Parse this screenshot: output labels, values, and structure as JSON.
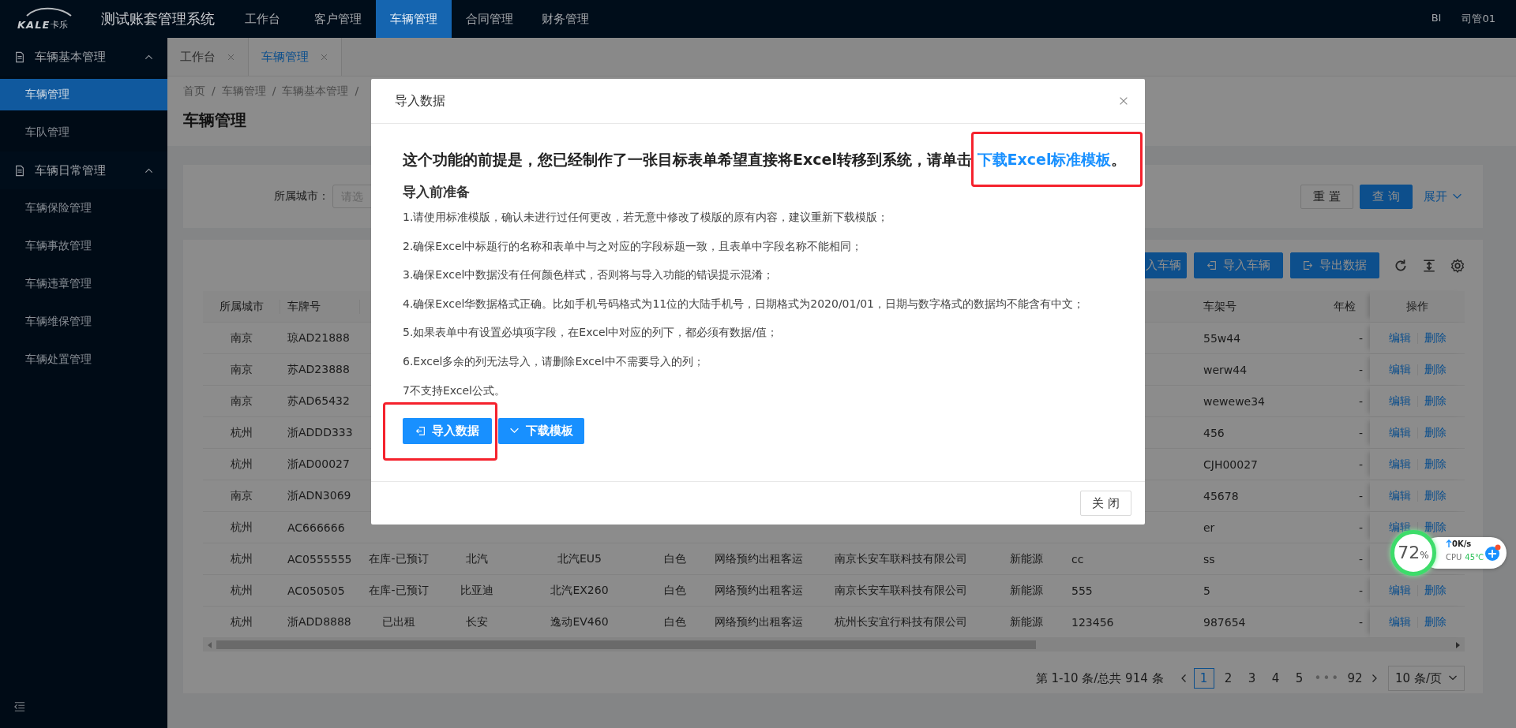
{
  "app": {
    "logo": {
      "mark": "KALE",
      "sub": "卡乐"
    },
    "title": "测试账套管理系统"
  },
  "nav": [
    {
      "label": "工作台",
      "selected": false
    },
    {
      "label": "客户管理",
      "selected": false
    },
    {
      "label": "车辆管理",
      "selected": true
    },
    {
      "label": "合同管理",
      "selected": false
    },
    {
      "label": "财务管理",
      "selected": false
    }
  ],
  "user_menu": [
    "BI",
    "司管01"
  ],
  "sidebar": {
    "groups": [
      {
        "label": "车辆基本管理",
        "expanded": true,
        "items": [
          {
            "label": "车辆管理",
            "selected": true
          },
          {
            "label": "车队管理",
            "selected": false
          }
        ]
      },
      {
        "label": "车辆日常管理",
        "expanded": true,
        "items": [
          {
            "label": "车辆保险管理",
            "selected": false
          },
          {
            "label": "车辆事故管理",
            "selected": false
          },
          {
            "label": "车辆违章管理",
            "selected": false
          },
          {
            "label": "车辆维保管理",
            "selected": false
          },
          {
            "label": "车辆处置管理",
            "selected": false
          }
        ]
      }
    ]
  },
  "tabs": [
    {
      "label": "工作台",
      "selected": false
    },
    {
      "label": "车辆管理",
      "selected": true
    }
  ],
  "breadcrumb": {
    "items": [
      "首页",
      "车辆管理",
      "车辆基本管理"
    ],
    "separator": "/"
  },
  "page_title": "车辆管理",
  "filter": {
    "label": "所属城市：",
    "placeholder": "请选",
    "buttons": [
      {
        "label": "重 置",
        "kind": "default"
      },
      {
        "label": "查 询",
        "kind": "primary"
      }
    ],
    "expand": "展开"
  },
  "toolbar": {
    "buttons": [
      {
        "label": "入车辆",
        "kind": "plain"
      },
      {
        "label": "导入车辆",
        "kind": "import"
      },
      {
        "label": "导出数据",
        "kind": "export"
      }
    ]
  },
  "table": {
    "columns": {
      "city": "所属城市",
      "plate": "车牌号",
      "frame_number": "车架号",
      "inspection": "年检",
      "actions": "操作"
    },
    "rows": [
      {
        "city": "南京",
        "plate": "琼AD21888",
        "frame_number": "55w44",
        "inspection": "-",
        "actions": [
          "编辑",
          "删除"
        ]
      },
      {
        "city": "南京",
        "plate": "苏AD23888",
        "frame_number": "werw44",
        "inspection": "-",
        "actions": [
          "编辑",
          "删除"
        ]
      },
      {
        "city": "南京",
        "plate": "苏AD65432",
        "frame_number": "wewewe34",
        "inspection": "-",
        "actions": [
          "编辑",
          "删除"
        ]
      },
      {
        "city": "杭州",
        "plate": "浙ADDD333",
        "frame_number": "456",
        "inspection": "-",
        "actions": [
          "编辑",
          "删除"
        ]
      },
      {
        "city": "杭州",
        "plate": "浙AD00027",
        "frame_number": "CJH00027",
        "inspection": "-",
        "actions": [
          "编辑",
          "删除"
        ]
      },
      {
        "city": "南京",
        "plate": "浙ADN3069",
        "frame_number": "45678",
        "inspection": "-",
        "actions": [
          "编辑",
          "删除"
        ]
      },
      {
        "city": "杭州",
        "plate": "AC666666",
        "frame_number": "er",
        "inspection": "-",
        "actions": [
          "编辑",
          "删除"
        ]
      },
      {
        "city": "杭州",
        "plate": "AC0555555",
        "column_3": "在库-已预订",
        "column_4": "北汽",
        "column_5": "北汽EU5",
        "column_6": "白色",
        "column_7": "网络预约出租客运",
        "column_8": "南京长安车联科技有限公司",
        "column_9": "新能源",
        "column_10": "cc",
        "frame_number": "ss",
        "inspection": "-"
      },
      {
        "city": "杭州",
        "plate": "AC050505",
        "column_3": "在库-已预订",
        "column_4": "比亚迪",
        "column_5": "北汽EX260",
        "column_6": "白色",
        "column_7": "网络预约出租客运",
        "column_8": "南京长安车联科技有限公司",
        "column_9": "新能源",
        "column_10": "555",
        "frame_number": "5",
        "inspection": "-",
        "actions": [
          "编辑",
          "删除"
        ]
      },
      {
        "city": "杭州",
        "plate": "浙ADD8888",
        "column_3": "已出租",
        "column_4": "长安",
        "column_5": "逸动EV460",
        "column_6": "白色",
        "column_7": "网络预约出租客运",
        "column_8": "杭州长安宜行科技有限公司",
        "column_9": "新能源",
        "column_10": "123456",
        "frame_number": "987654",
        "inspection": "-",
        "actions": [
          "编辑",
          "删除"
        ]
      }
    ]
  },
  "pagination": {
    "summary": "第 1-10 条/总共 914 条",
    "pages": [
      {
        "label": "1",
        "kind": "page",
        "selected": true
      },
      {
        "label": "2",
        "kind": "page",
        "selected": false
      },
      {
        "label": "3",
        "kind": "page",
        "selected": false
      },
      {
        "label": "4",
        "kind": "page",
        "selected": false
      },
      {
        "label": "5",
        "kind": "page",
        "selected": false
      },
      {
        "label": "•••",
        "kind": "ellipsis"
      },
      {
        "label": "92",
        "kind": "page",
        "selected": false
      }
    ],
    "page_size": "10 条/页"
  },
  "modal": {
    "title": "导入数据",
    "headline": {
      "before": "这个功能的前提是，您已经制作了一张目标表单希望直接将Excel转移到系统，请单击 ",
      "link": "下载Excel标准模板",
      "after": "。",
      "link_highlighted": true
    },
    "section_title": "导入前准备",
    "steps": [
      "1.请使用标准模版，确认未进行过任何更改，若无意中修改了模版的原有内容，建议重新下载模版；",
      "2.确保Excel中标题行的名称和表单中与之对应的字段标题一致，且表单中字段名称不能相同；",
      "3.确保Excel中数据没有任何颜色样式，否则将与导入功能的错误提示混淆；",
      "4.确保Excel华数据格式正确。比如手机号码格式为11位的大陆手机号，日期格式为2020/01/01，日期与数字格式的数据均不能含有中文；",
      "5.如果表单中有设置必填项字段，在Excel中对应的列下，都必须有数据/值；",
      "6.Excel多余的列无法导入，请删除Excel中不需要导入的列；",
      "7不支持Excel公式。"
    ],
    "actions": [
      {
        "label": "导入数据",
        "kind": "import",
        "highlighted": true
      },
      {
        "label": "下载模板",
        "kind": "download"
      }
    ],
    "footer_button": "关 闭"
  },
  "monitor": {
    "percent": "72",
    "unit": "%",
    "speed": "0K/s",
    "cpu_label": "CPU",
    "temperature": "45℃"
  }
}
